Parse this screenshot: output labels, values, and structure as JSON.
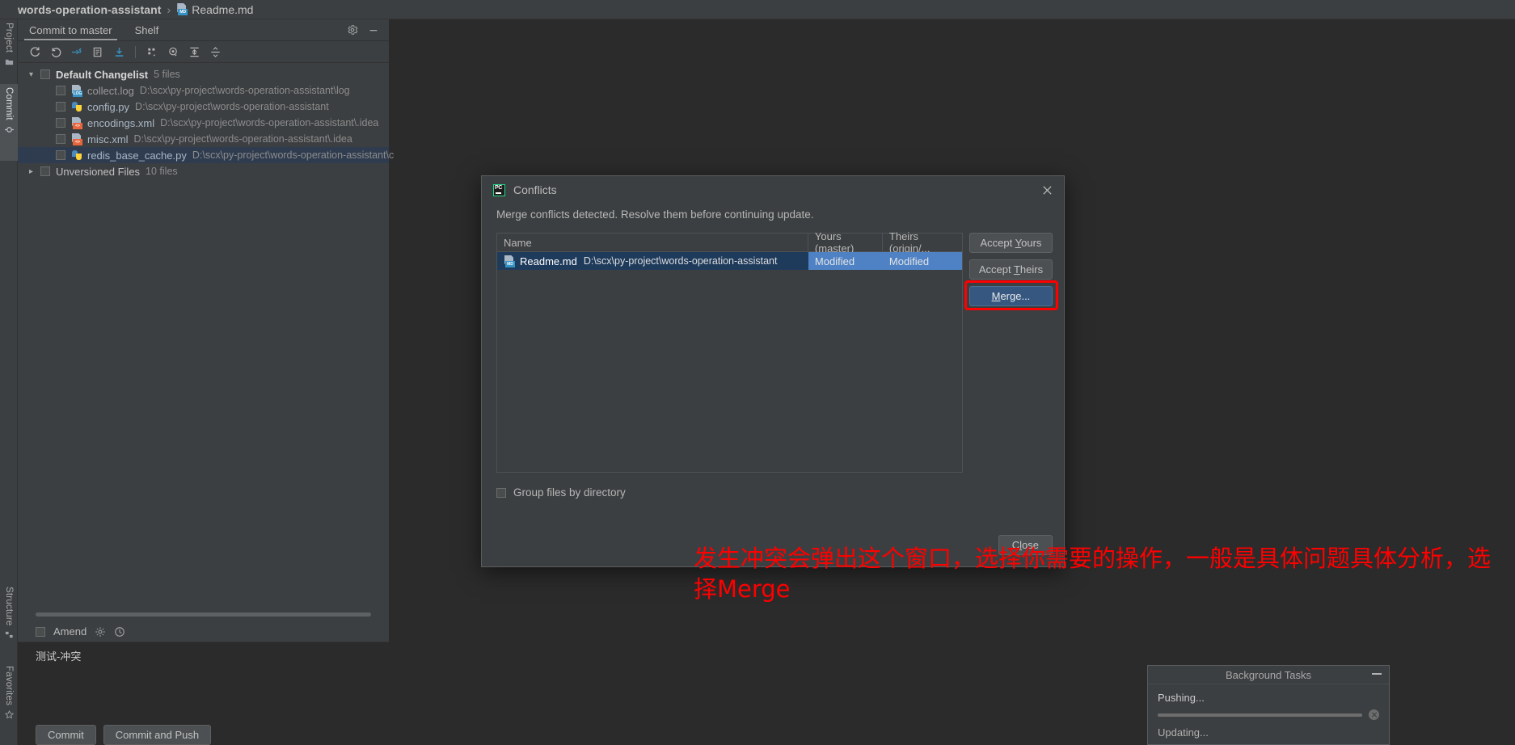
{
  "breadcrumb": {
    "project": "words-operation-assistant",
    "separator": "›",
    "file": "Readme.md",
    "file_icon": "markdown-file-icon",
    "file_icon_tag": "MD"
  },
  "tool_strip": {
    "tabs": [
      {
        "label": "Project",
        "icon": "project-folder-icon",
        "active": false
      },
      {
        "label": "Commit",
        "icon": "commit-diamond-icon",
        "active": true
      },
      {
        "label": "Structure",
        "icon": "structure-icon",
        "active": false
      },
      {
        "label": "Favorites",
        "icon": "favorites-star-icon",
        "active": false
      }
    ]
  },
  "commit_panel": {
    "tabs": [
      {
        "label": "Commit to master",
        "active": true
      },
      {
        "label": "Shelf",
        "active": false
      }
    ],
    "title_actions": [
      {
        "name": "gear-icon",
        "label": "Settings"
      },
      {
        "name": "minimize-icon",
        "label": "Hide"
      }
    ],
    "toolbar": [
      {
        "name": "refresh-icon",
        "label": "Refresh Changes"
      },
      {
        "name": "rollback-icon",
        "label": "Rollback"
      },
      {
        "name": "show-diff-icon",
        "label": "Show Diff"
      },
      {
        "name": "move-to-changelist-icon",
        "label": "Move to Another Changelist"
      },
      {
        "name": "get-from-vcs-icon",
        "label": "Update Project"
      },
      {
        "name": "group-by-icon",
        "label": "Group By"
      },
      {
        "name": "preview-icon",
        "label": "Preview Diff"
      },
      {
        "name": "expand-all-icon",
        "label": "Expand All"
      },
      {
        "name": "collapse-all-icon",
        "label": "Collapse All"
      }
    ],
    "tree": [
      {
        "type": "group",
        "name": "Default Changelist",
        "count": "5 files",
        "expanded": true,
        "checked": false,
        "children": [
          {
            "name": "collect.log",
            "path": "D:\\scx\\py-project\\words-operation-assistant\\log",
            "icon": "log-file-icon",
            "tag": "LOG",
            "tag_color": "#3592c4",
            "name_color": "gray",
            "selected": false
          },
          {
            "name": "config.py",
            "path": "D:\\scx\\py-project\\words-operation-assistant",
            "icon": "python-file-icon",
            "tag": "",
            "tag_color": "",
            "name_color": "blue",
            "selected": false
          },
          {
            "name": "encodings.xml",
            "path": "D:\\scx\\py-project\\words-operation-assistant\\.idea",
            "icon": "xml-file-icon",
            "tag": "<>",
            "tag_color": "#e8663d",
            "name_color": "blue",
            "selected": false
          },
          {
            "name": "misc.xml",
            "path": "D:\\scx\\py-project\\words-operation-assistant\\.idea",
            "icon": "xml-file-icon",
            "tag": "<>",
            "tag_color": "#e8663d",
            "name_color": "blue",
            "selected": false
          },
          {
            "name": "redis_base_cache.py",
            "path": "D:\\scx\\py-project\\words-operation-assistant\\c",
            "icon": "python-file-icon",
            "tag": "",
            "tag_color": "",
            "name_color": "blue",
            "selected": true
          }
        ]
      },
      {
        "type": "group",
        "name": "Unversioned Files",
        "count": "10 files",
        "expanded": false,
        "checked": false,
        "children": []
      }
    ],
    "amend": {
      "label": "Amend",
      "checked": false,
      "accel": "m"
    },
    "amend_actions": [
      {
        "name": "commit-options-gear-icon"
      },
      {
        "name": "commit-history-clock-icon"
      }
    ],
    "commit_message": "测试-冲突",
    "buttons": [
      {
        "label": "Commit"
      },
      {
        "label": "Commit and Push"
      }
    ]
  },
  "dialog": {
    "icon": "pycharm-logo-icon",
    "title": "Conflicts",
    "close_icon": "close-icon",
    "description": "Merge conflicts detected. Resolve them before continuing update.",
    "table": {
      "columns": [
        "Name",
        "Yours (master)",
        "Theirs (origin/..."
      ],
      "rows": [
        {
          "icon": "markdown-file-icon",
          "icon_tag": "MD",
          "name": "Readme.md",
          "path": "D:\\scx\\py-project\\words-operation-assistant",
          "yours": "Modified",
          "theirs": "Modified",
          "selected": true
        }
      ]
    },
    "actions": [
      {
        "label": "Accept Yours",
        "accel": "Y",
        "primary": false,
        "highlighted": false
      },
      {
        "label": "Accept Theirs",
        "accel": "T",
        "primary": false,
        "highlighted": false
      },
      {
        "label": "Merge...",
        "accel": "M",
        "primary": true,
        "highlighted": true
      }
    ],
    "group_checkbox": {
      "label": "Group files by directory",
      "checked": false
    },
    "close_button": {
      "label": "Close",
      "accel": "l"
    }
  },
  "annotation": {
    "text": "发生冲突会弹出这个窗口，选择你需要的操作，一般是具体问题具体分析，选择Merge",
    "color": "#fe0000"
  },
  "background_tasks": {
    "title": "Background Tasks",
    "minimize_icon": "minimize-icon",
    "items": [
      {
        "label": "Pushing...",
        "has_progress": true,
        "cancel_icon": "cancel-icon"
      },
      {
        "label": "Updating...",
        "has_progress": false
      }
    ]
  },
  "colors": {
    "window_bg": "#3c3f41",
    "editor_bg": "#2b2b2b",
    "accent_blue": "#4e82c4",
    "selection_row": "#1f3b5c",
    "primary_button": "#365880",
    "highlight_red": "#fe0000",
    "link_blue": "#a9b7c6"
  }
}
